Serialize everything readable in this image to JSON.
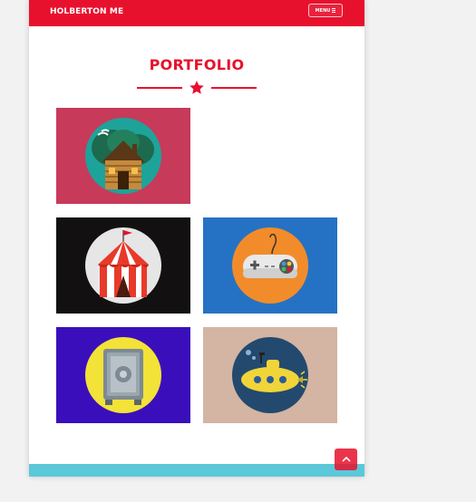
{
  "navbar": {
    "brand": "HOLBERTON ME",
    "menu_label": "MENU",
    "menu_icon": "hamburger-icon",
    "background": "#e8112d"
  },
  "portfolio": {
    "title": "PORTFOLIO",
    "divider_icon": "star-icon",
    "items": [
      {
        "name": "cabin",
        "icon": "log-cabin-icon",
        "background": "#c73a5a"
      },
      {
        "name": "circus",
        "icon": "circus-tent-icon",
        "background": "#121010"
      },
      {
        "name": "game",
        "icon": "game-controller-icon",
        "background": "#2572c4"
      },
      {
        "name": "safe",
        "icon": "safe-icon",
        "background": "#3a0fbb"
      },
      {
        "name": "submarine",
        "icon": "submarine-icon",
        "background": "#d4b4a2"
      }
    ]
  },
  "scroll_top": {
    "icon": "chevron-up-icon"
  },
  "footer": {
    "color": "#5bc8d9"
  }
}
